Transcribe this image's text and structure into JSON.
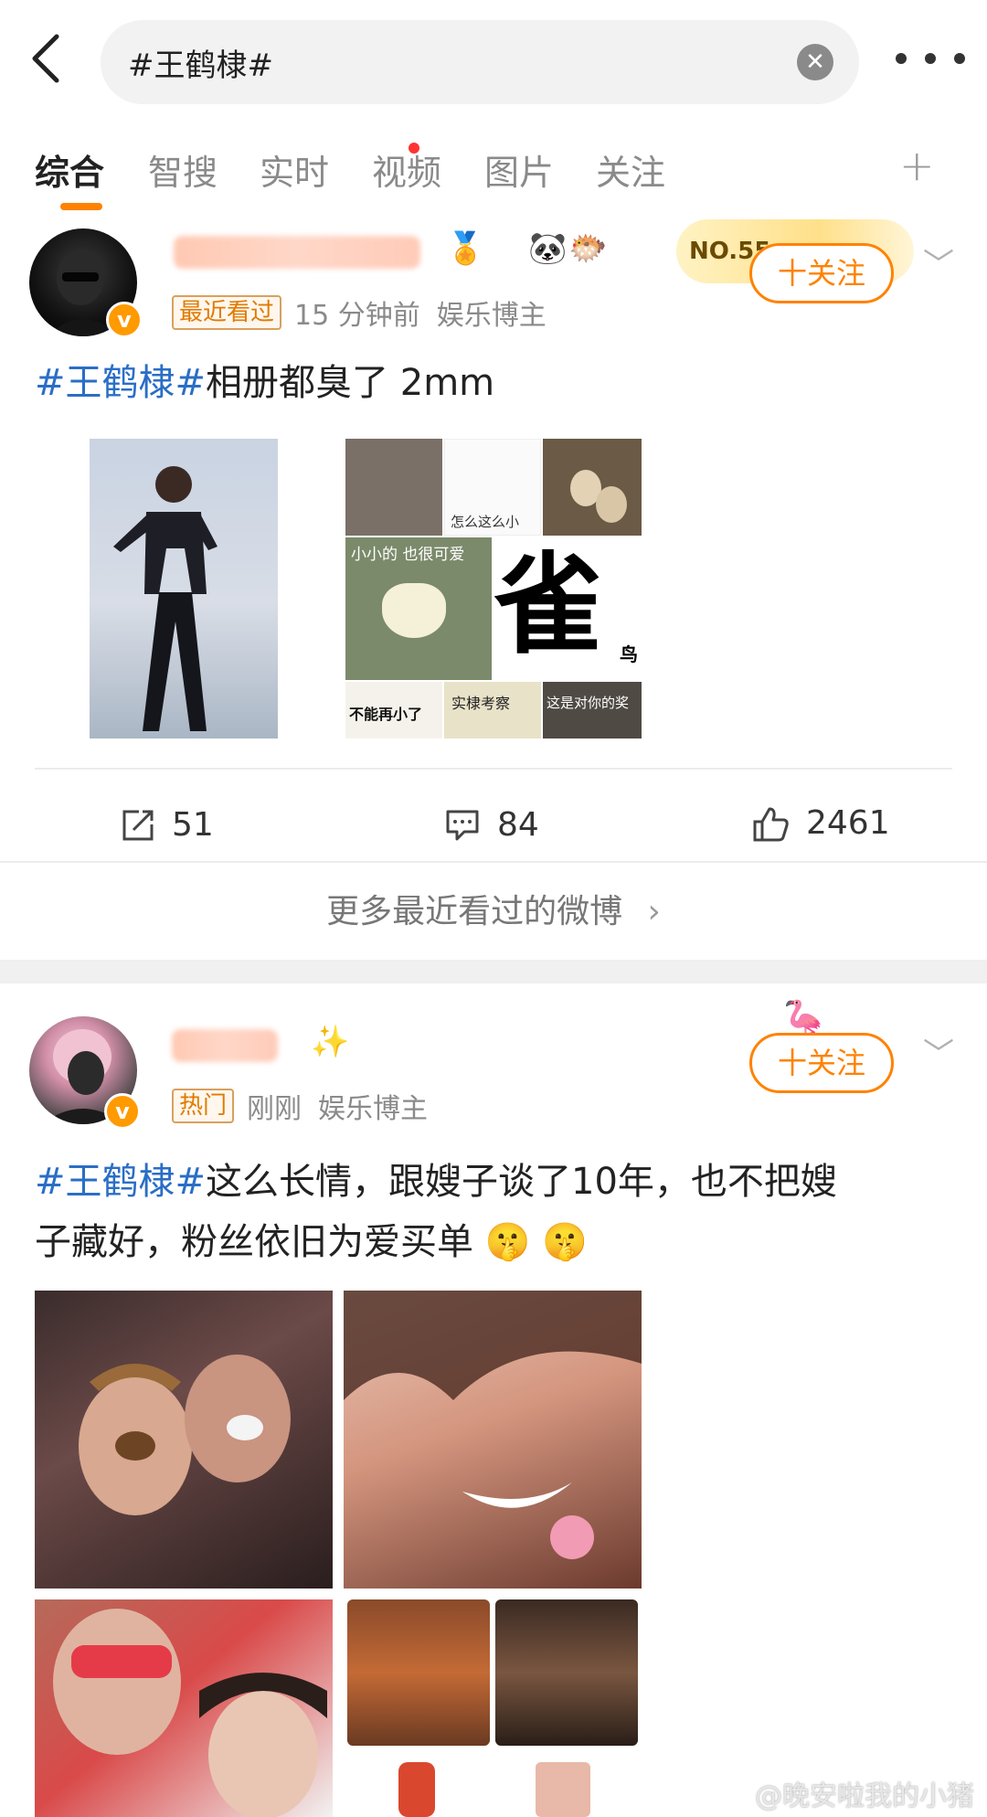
{
  "search": {
    "query": "#王鹤棣#"
  },
  "tabs": [
    {
      "label": "综合",
      "active": true
    },
    {
      "label": "智搜"
    },
    {
      "label": "实时",
      "has_dot": true
    },
    {
      "label": "视频"
    },
    {
      "label": "图片"
    },
    {
      "label": "关注"
    }
  ],
  "add_tab_symbol": "+",
  "posts": [
    {
      "tag": "最近看过",
      "time": "15 分钟前",
      "role": "娱乐博主",
      "rank_text": "NO.55",
      "follow_label": "十关注",
      "hashtag": "#王鹤棣#",
      "text": "相册都臭了 2mm",
      "stats": {
        "reposts": "51",
        "comments": "84",
        "likes": "2461"
      },
      "image_captions": [
        "怎么这么小",
        "小小的 也很可爱",
        "雀",
        "鸟",
        "不能再小了",
        "实棣考察",
        "这是对你的奖"
      ]
    },
    {
      "tag": "热门",
      "time": "刚刚",
      "role": "娱乐博主",
      "follow_label": "十关注",
      "hashtag": "#王鹤棣#",
      "text_line1": "这么长情，跟嫂子谈了10年，也不把嫂",
      "text_line2": "子藏好，粉丝依旧为爱买单 🤫 🤫"
    }
  ],
  "more_recent_link": "更多最近看过的微博",
  "watermark": "@晚安啦我的小猪",
  "colors": {
    "accent": "#ff8200",
    "hashtag": "#2a6ec6",
    "muted": "#8a8a8a"
  }
}
